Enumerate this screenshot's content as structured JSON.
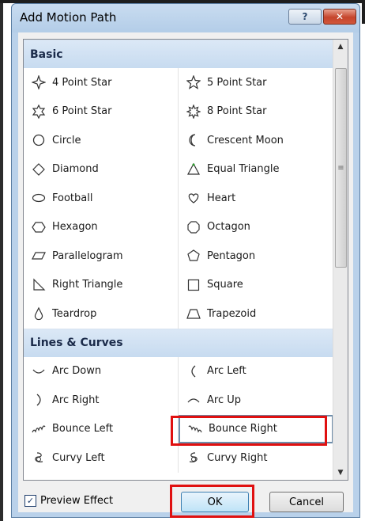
{
  "dialog": {
    "title": "Add Motion Path",
    "help_glyph": "?",
    "close_glyph": "✕"
  },
  "sections": [
    {
      "title": "Basic",
      "items": [
        {
          "label": "4 Point Star",
          "icon": "star4-icon"
        },
        {
          "label": "5 Point Star",
          "icon": "star5-icon"
        },
        {
          "label": "6 Point Star",
          "icon": "star6-icon"
        },
        {
          "label": "8 Point Star",
          "icon": "star8-icon"
        },
        {
          "label": "Circle",
          "icon": "circle-icon"
        },
        {
          "label": "Crescent Moon",
          "icon": "crescent-moon-icon"
        },
        {
          "label": "Diamond",
          "icon": "diamond-icon"
        },
        {
          "label": "Equal Triangle",
          "icon": "equal-triangle-icon"
        },
        {
          "label": "Football",
          "icon": "football-icon"
        },
        {
          "label": "Heart",
          "icon": "heart-icon"
        },
        {
          "label": "Hexagon",
          "icon": "hexagon-icon"
        },
        {
          "label": "Octagon",
          "icon": "octagon-icon"
        },
        {
          "label": "Parallelogram",
          "icon": "parallelogram-icon"
        },
        {
          "label": "Pentagon",
          "icon": "pentagon-icon"
        },
        {
          "label": "Right Triangle",
          "icon": "right-triangle-icon"
        },
        {
          "label": "Square",
          "icon": "square-icon"
        },
        {
          "label": "Teardrop",
          "icon": "teardrop-icon"
        },
        {
          "label": "Trapezoid",
          "icon": "trapezoid-icon"
        }
      ]
    },
    {
      "title": "Lines & Curves",
      "items": [
        {
          "label": "Arc Down",
          "icon": "arc-down-icon"
        },
        {
          "label": "Arc Left",
          "icon": "arc-left-icon"
        },
        {
          "label": "Arc Right",
          "icon": "arc-right-icon"
        },
        {
          "label": "Arc Up",
          "icon": "arc-up-icon"
        },
        {
          "label": "Bounce Left",
          "icon": "bounce-left-icon"
        },
        {
          "label": "Bounce Right",
          "icon": "bounce-right-icon",
          "selected": true
        },
        {
          "label": "Curvy Left",
          "icon": "curvy-left-icon"
        },
        {
          "label": "Curvy Right",
          "icon": "curvy-right-icon"
        }
      ]
    }
  ],
  "footer": {
    "preview_label": "Preview Effect",
    "preview_checked": true,
    "ok_label": "OK",
    "cancel_label": "Cancel"
  },
  "colors": {
    "highlight_red": "#e01010",
    "section_header_bg": "#c7dbf0"
  }
}
